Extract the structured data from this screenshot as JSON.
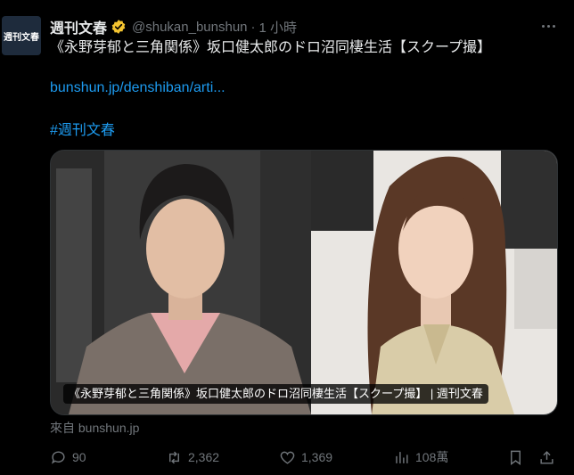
{
  "author": {
    "avatar_text": "週刊文春",
    "name": "週刊文春",
    "handle": "@shukan_bunshun",
    "separator": "·",
    "time": "1 小時"
  },
  "tweet": {
    "text": "《永野芽郁と三角関係》坂口健太郎のドロ沼同棲生活【スクープ撮】",
    "link": "bunshun.jp/denshiban/arti...",
    "hashtag": "#週刊文春"
  },
  "card": {
    "caption": "《永野芽郁と三角関係》坂口健太郎のドロ沼同棲生活【スクープ撮】 | 週刊文春",
    "source": "來自 bunshun.jp"
  },
  "actions": {
    "replies": "90",
    "retweets": "2,362",
    "likes": "1,369",
    "views": "108萬"
  },
  "colors": {
    "background": "#000000",
    "text": "#e7e9ea",
    "muted": "#71767b",
    "link": "#1d9bf0",
    "verified": "#f4c430"
  },
  "icons": [
    "more-icon",
    "verified-badge-icon",
    "reply-icon",
    "retweet-icon",
    "like-icon",
    "views-icon",
    "bookmark-icon",
    "share-icon"
  ]
}
